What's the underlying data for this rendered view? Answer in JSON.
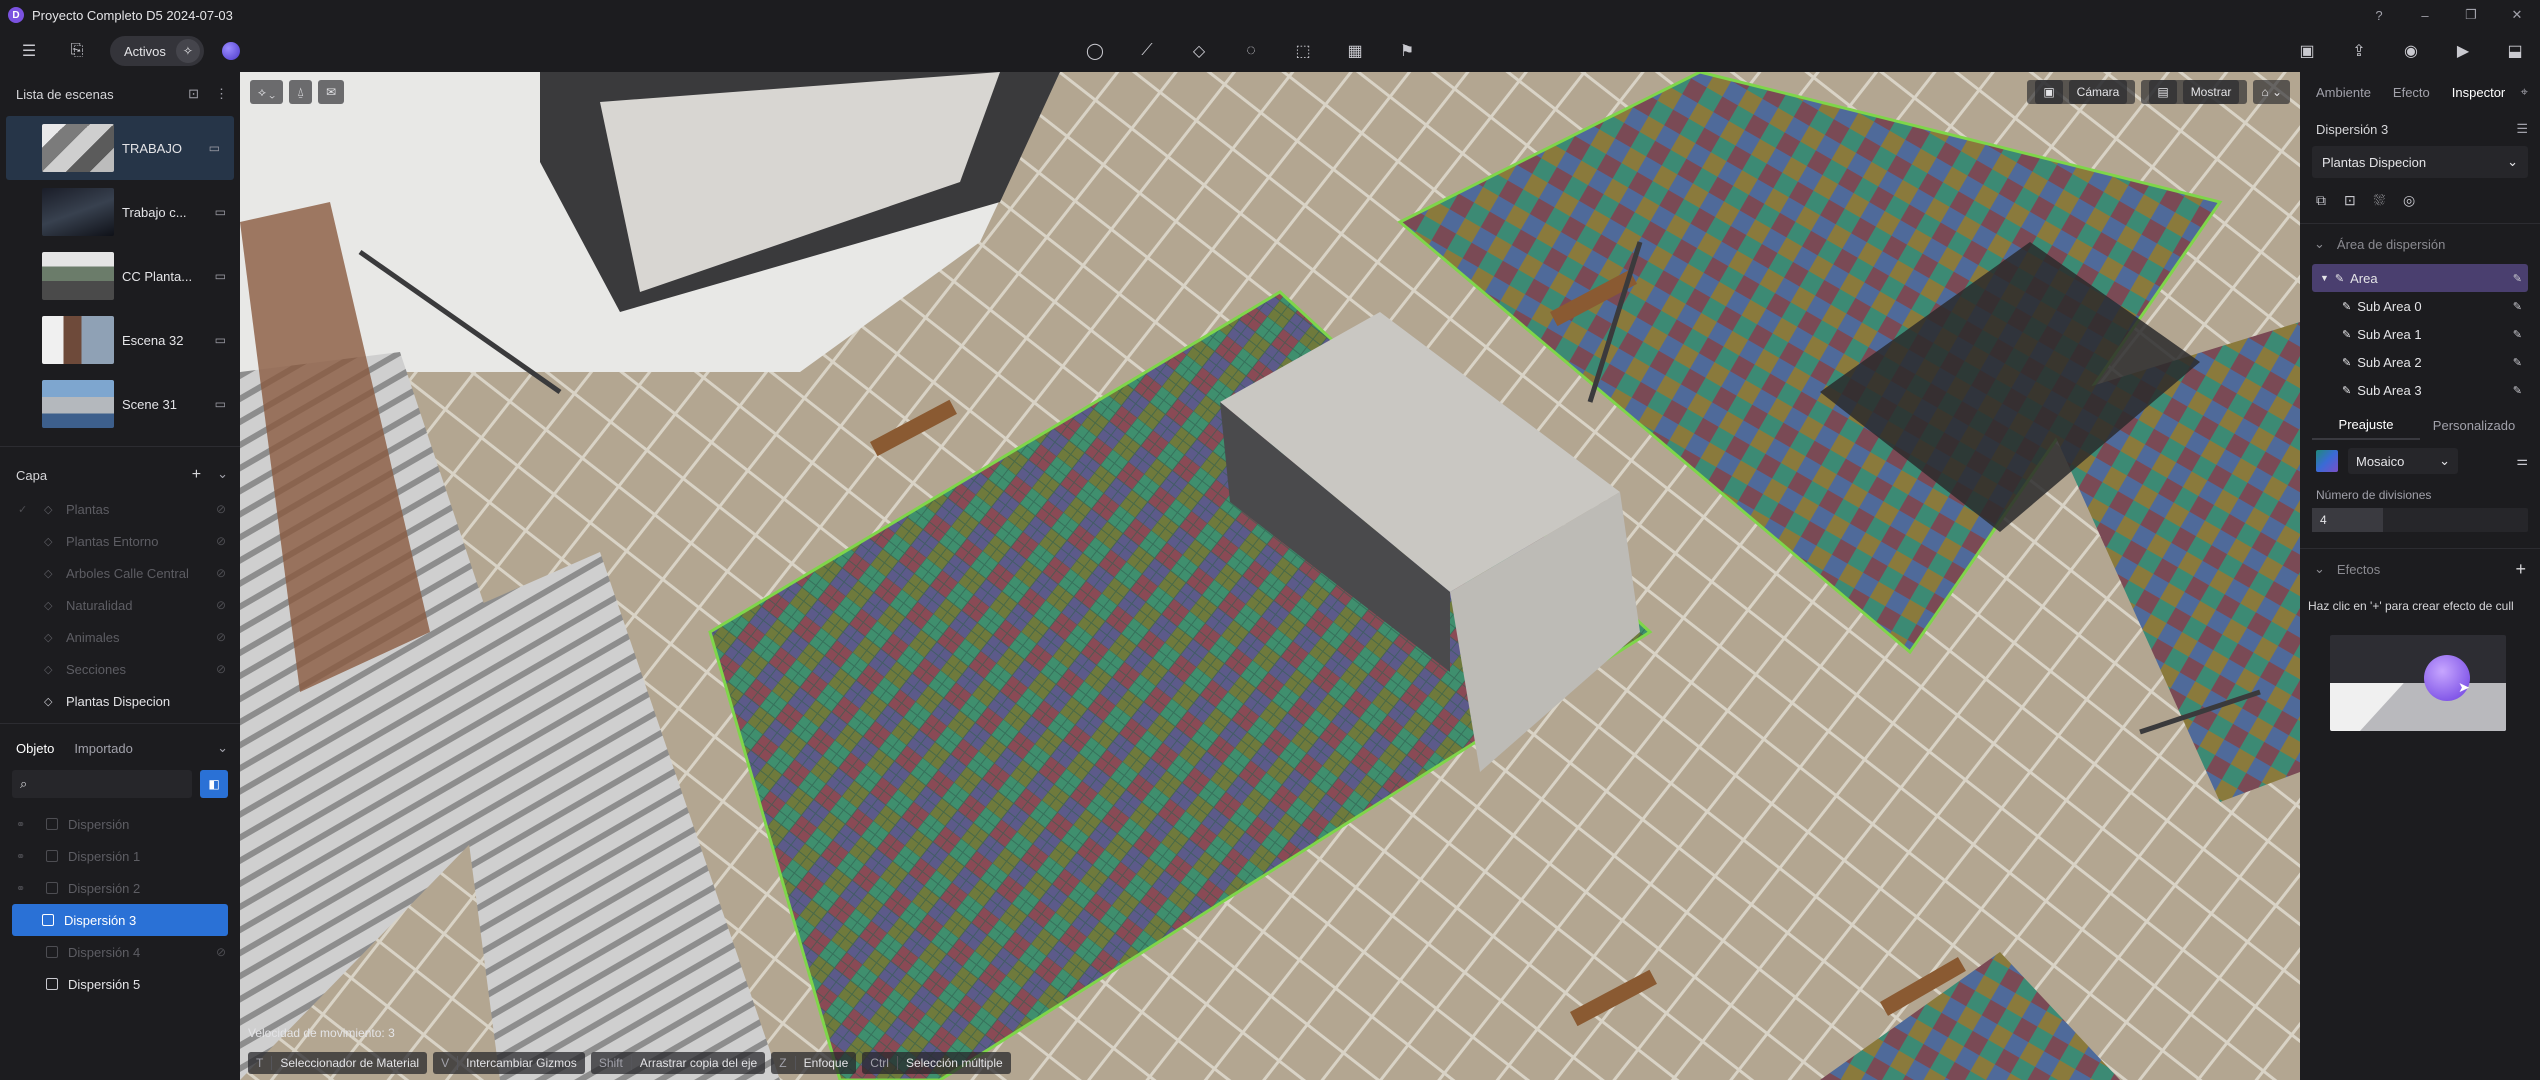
{
  "window": {
    "title": "Proyecto Completo D5 2024-07-03",
    "controls": [
      "?",
      "–",
      "❐",
      "✕"
    ]
  },
  "toolbar": {
    "assets_label": "Activos"
  },
  "scenes_panel": {
    "title": "Lista de escenas",
    "scenes": [
      {
        "name": "TRABAJO",
        "active": true
      },
      {
        "name": "Trabajo c...",
        "active": false
      },
      {
        "name": "CC Planta...",
        "active": false
      },
      {
        "name": "Escena 32",
        "active": false
      },
      {
        "name": "Scene 31",
        "active": false
      }
    ]
  },
  "layers_panel": {
    "title": "Capa",
    "layers": [
      {
        "name": "Plantas",
        "visible": false
      },
      {
        "name": "Plantas Entorno",
        "visible": false
      },
      {
        "name": "Arboles Calle Central",
        "visible": false
      },
      {
        "name": "Naturalidad",
        "visible": false
      },
      {
        "name": "Animales",
        "visible": false
      },
      {
        "name": "Secciones",
        "visible": false
      },
      {
        "name": "Plantas Dispecion",
        "visible": true
      }
    ]
  },
  "objects_panel": {
    "tabs": [
      "Objeto",
      "Importado"
    ],
    "search_value": "",
    "objects": [
      {
        "name": "Dispersión",
        "state": "hidden"
      },
      {
        "name": "Dispersión 1",
        "state": "hidden"
      },
      {
        "name": "Dispersión 2",
        "state": "hidden"
      },
      {
        "name": "Dispersión 3",
        "state": "selected"
      },
      {
        "name": "Dispersión 4",
        "state": "hidden"
      },
      {
        "name": "Dispersión 5",
        "state": "visible"
      }
    ]
  },
  "viewport": {
    "camera_label": "Cámara",
    "show_label": "Mostrar",
    "status_text": "Velocidad de movimiento: 3",
    "shortcuts": [
      {
        "key": "T",
        "label": "Seleccionador de Material"
      },
      {
        "key": "V",
        "label": "Intercambiar Gizmos"
      },
      {
        "key": "Shift",
        "label": "Arrastrar copia del eje"
      },
      {
        "key": "Z",
        "label": "Enfoque"
      },
      {
        "key": "Ctrl",
        "label": "Selección múltiple"
      }
    ]
  },
  "inspector": {
    "tabs": [
      "Ambiente",
      "Efecto",
      "Inspector"
    ],
    "active_tab": "Inspector",
    "object_name": "Dispersión 3",
    "layer_dropdown": "Plantas Dispecion",
    "scatter_area_title": "Área de dispersión",
    "areas": [
      {
        "name": "Area",
        "main": true
      },
      {
        "name": "Sub Area 0",
        "main": false
      },
      {
        "name": "Sub Area 1",
        "main": false
      },
      {
        "name": "Sub Area 2",
        "main": false
      },
      {
        "name": "Sub Area 3",
        "main": false
      }
    ],
    "mode_tabs": [
      "Preajuste",
      "Personalizado"
    ],
    "pattern_dropdown": "Mosaico",
    "divisions_label": "Número de divisiones",
    "divisions_value": "4",
    "divisions_fraction": 0.33,
    "effects_title": "Efectos",
    "effects_hint": "Haz clic en '+' para crear efecto de cull"
  },
  "colors": {
    "accent": "#2a71d6",
    "area_selected": "#4a3f6f",
    "panel_bg": "#1c1c1f"
  }
}
